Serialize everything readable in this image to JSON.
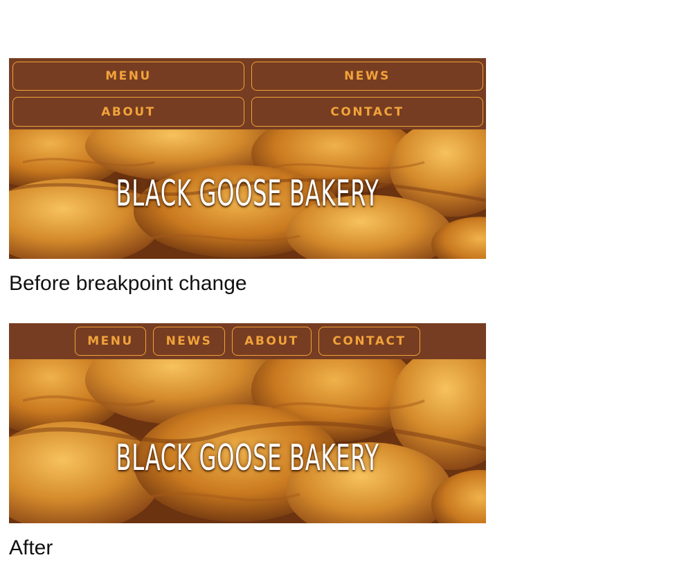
{
  "nav": {
    "items": [
      {
        "label": "MENU"
      },
      {
        "label": "NEWS"
      },
      {
        "label": "ABOUT"
      },
      {
        "label": "CONTACT"
      }
    ]
  },
  "hero": {
    "wordmark": "BLACK GOOSE BAKERY"
  },
  "captions": {
    "before": "Before breakpoint change",
    "after": "After"
  },
  "colors": {
    "nav_background": "#763d22",
    "button_accent": "#f2a33a",
    "wordmark_text": "#ffffff"
  }
}
